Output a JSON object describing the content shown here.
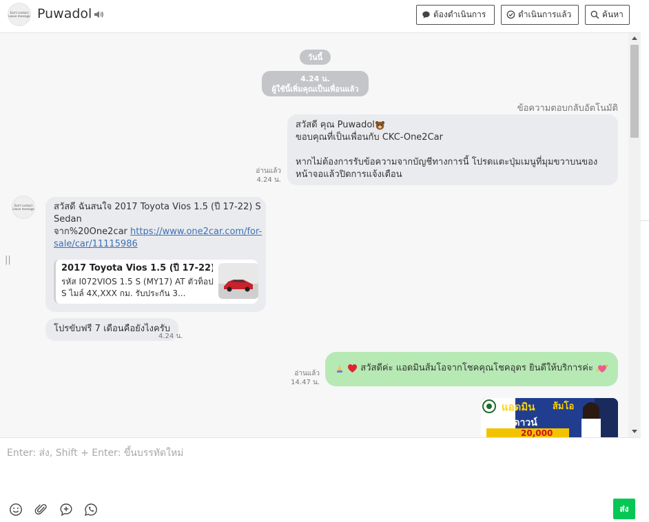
{
  "header": {
    "avatar_text": [
      "Ean't contact",
      "Leave message"
    ],
    "name": "Puwadol",
    "buttons": {
      "todo": "ต้องดำเนินการ",
      "done": "ดำเนินการแล้ว",
      "search": "ค้นหา"
    }
  },
  "chat": {
    "day_label": "วันนี้",
    "system_time": "4.24 น.",
    "system_msg": "ผู้ใช้นี้เพิ่มคุณเป็นเพื่อนแล้ว",
    "auto_reply_label": "ข้อความตอบกลับอัตโนมัติ",
    "auto_reply": {
      "line1": "สวัสดี คุณ Puwadol",
      "line2": "ขอบคุณที่เป็นเพื่อนกับ CKC-One2Car",
      "line3": "หากไม่ต้องการรับข้อความจากบัญชีทางการนี้ โปรดแตะปุ่มเมนูที่มุมขวาบนของ",
      "line4": "หน้าจอแล้วปิดการแจ้งเตือน",
      "read": "อ่านแล้ว",
      "time": "4.24 น."
    },
    "incoming1": {
      "line1": "สวัสดี ฉันสนใจ 2017 Toyota Vios 1.5 (ปี 17-22) S",
      "line2": "Sedan",
      "line3_prefix": "จาก%20One2car ",
      "link1": "https://www.one2car.com/for-",
      "link2": "sale/car/11115986",
      "card_title": "2017 Toyota Vios 1.5 (ปี 17-22) ...",
      "card_desc": "รหัส I072VIOS 1.5 S (MY17) AT ตัวท็อป S ไมล์ 4X,XXX กม. รับประกัน 3..."
    },
    "incoming2": {
      "text": "โปรขับฟรี 7 เดือนคือยังไงครับ",
      "time": "4.24 น."
    },
    "outgoing": {
      "text": "สวัสดีค่ะ แอดมินส้มโอจากโชคคุณโชคอุดร ยินดีให้บริการค่ะ",
      "read": "อ่านแล้ว",
      "time": "14.47 น."
    },
    "promo": {
      "line1": "แอดมิน",
      "line2": "ส้มโอ",
      "line3": "ฟรีดาวน์",
      "line4": "20,000"
    }
  },
  "composer": {
    "placeholder": "Enter: ส่ง, Shift + Enter: ขึ้นบรรทัดใหม่",
    "send_label": "ส่ง"
  },
  "colors": {
    "send": "#06c755",
    "outgoing_bubble": "#b6e9b4",
    "incoming_bubble": "#eaebee",
    "link": "#3b6fb6"
  },
  "icons": [
    "speaker-icon",
    "comment-icon",
    "check-comment-icon",
    "search-icon",
    "emoji-icon",
    "attachment-icon",
    "add-comment-icon",
    "whatsapp-icon"
  ]
}
